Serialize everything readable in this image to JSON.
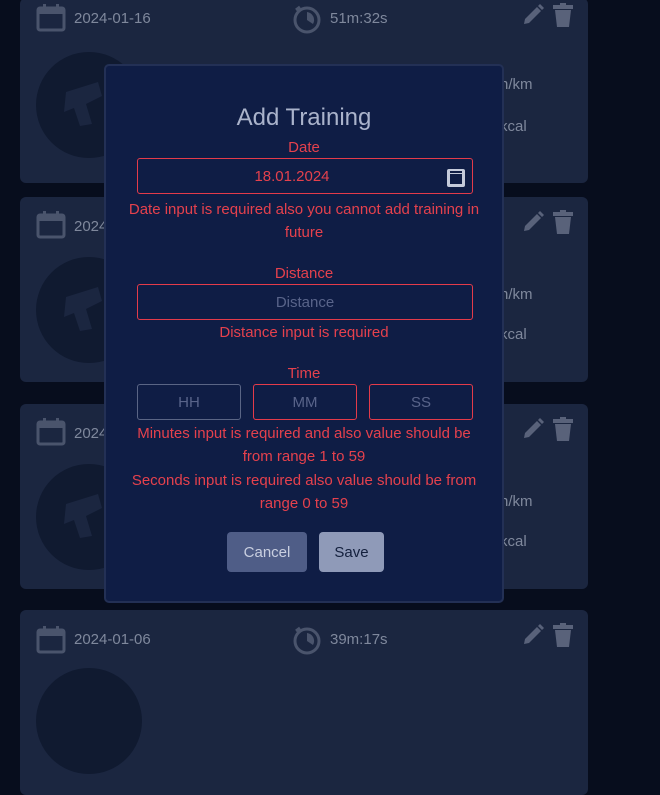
{
  "cards": [
    {
      "date": "2024-01-16",
      "duration": "51m:32s",
      "pace": "n/km",
      "kcal": "kcal"
    },
    {
      "date": "2024",
      "duration": "",
      "pace": "n/km",
      "kcal": "kcal"
    },
    {
      "date": "2024",
      "duration": "",
      "pace": "n/km",
      "kcal": "kcal"
    },
    {
      "date": "2024-01-06",
      "duration": "39m:17s",
      "pace": "",
      "kcal": ""
    }
  ],
  "modal": {
    "title": "Add Training",
    "date": {
      "label": "Date",
      "value": "18.01.2024",
      "error": "Date input is required also you cannot add training in future"
    },
    "distance": {
      "label": "Distance",
      "placeholder": "Distance",
      "error": "Distance input is required"
    },
    "time": {
      "label": "Time",
      "hh_placeholder": "HH",
      "mm_placeholder": "MM",
      "ss_placeholder": "SS",
      "error_minutes": "Minutes input is required and also value should be from range 1 to 59",
      "error_seconds": "Seconds input is required also value should be from range 0 to 59"
    },
    "cancel_label": "Cancel",
    "save_label": "Save"
  },
  "colors": {
    "background": "#070d1d",
    "card": "#1b2640",
    "modal": "#0f1d45",
    "error": "#e5414d",
    "cancel": "#4f5d87",
    "save": "#8f9ab8"
  },
  "icons": [
    "calendar-icon",
    "stopwatch-icon",
    "edit-icon",
    "trash-icon",
    "runner-avatar-icon",
    "date-picker-icon"
  ]
}
